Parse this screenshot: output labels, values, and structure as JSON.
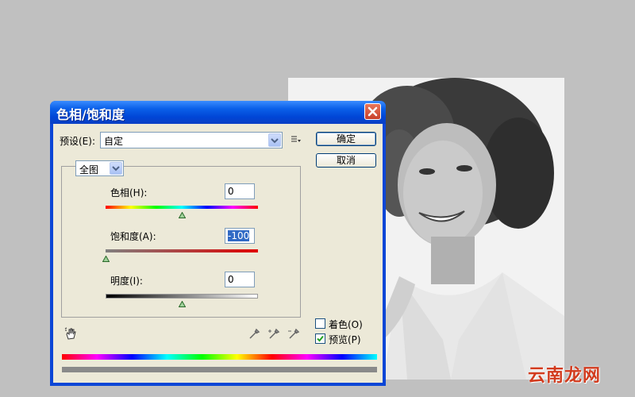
{
  "dialog": {
    "title": "色相/饱和度",
    "preset": {
      "label": "预设(E):",
      "value": "自定"
    },
    "ok_label": "确定",
    "cancel_label": "取消",
    "edit": {
      "value": "全图"
    },
    "hue": {
      "label": "色相(H):",
      "value": "0",
      "level": 0.5
    },
    "saturation": {
      "label": "饱和度(A):",
      "value": "-100",
      "level": 0.0
    },
    "lightness": {
      "label": "明度(I):",
      "value": "0",
      "level": 0.5
    },
    "colorize": {
      "label": "着色(O)",
      "checked": false
    },
    "preview": {
      "label": "预览(P)",
      "checked": true
    }
  },
  "watermark": "云南龙网"
}
